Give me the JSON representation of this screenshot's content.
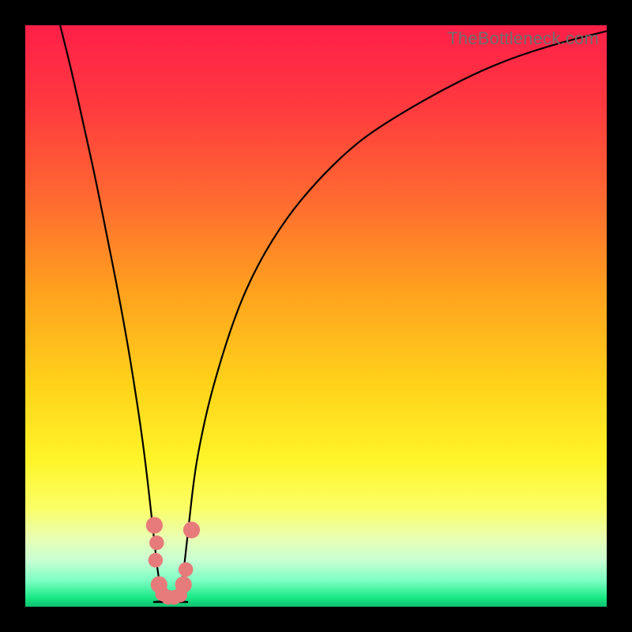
{
  "watermark": "TheBottleneck.com",
  "colors": {
    "frame": "#000000",
    "curve": "#000000",
    "dots": "#e77b7b",
    "gradient_stops": [
      {
        "pos": 0.0,
        "color": "#ff1f48"
      },
      {
        "pos": 0.14,
        "color": "#ff3a3f"
      },
      {
        "pos": 0.3,
        "color": "#ff6a30"
      },
      {
        "pos": 0.46,
        "color": "#ffa21e"
      },
      {
        "pos": 0.62,
        "color": "#ffd31a"
      },
      {
        "pos": 0.75,
        "color": "#fff52a"
      },
      {
        "pos": 0.83,
        "color": "#fbff66"
      },
      {
        "pos": 0.88,
        "color": "#eaffb0"
      },
      {
        "pos": 0.92,
        "color": "#c8ffd4"
      },
      {
        "pos": 0.955,
        "color": "#7dffc3"
      },
      {
        "pos": 0.985,
        "color": "#17e884"
      },
      {
        "pos": 1.0,
        "color": "#0fc06f"
      }
    ]
  },
  "chart_data": {
    "type": "line",
    "title": "",
    "xlabel": "",
    "ylabel": "",
    "xlim": [
      0,
      100
    ],
    "ylim": [
      0,
      100
    ],
    "notch_x": 25,
    "notch_half_width": 3,
    "series": [
      {
        "name": "bottleneck-curve",
        "x": [
          6,
          8,
          10,
          12,
          14,
          16,
          18,
          20,
          21,
          22,
          23,
          24,
          25,
          26,
          27,
          28,
          29,
          30,
          32,
          36,
          40,
          45,
          50,
          55,
          60,
          70,
          80,
          90,
          100
        ],
        "y": [
          100,
          92,
          83,
          74,
          64,
          54,
          43,
          30,
          22,
          13,
          4,
          1,
          0.5,
          1,
          4,
          13,
          22,
          28,
          37,
          50,
          59,
          67,
          73,
          78,
          82,
          88,
          93,
          96.5,
          99
        ]
      }
    ],
    "dots": [
      {
        "x": 22.2,
        "y": 14,
        "r": 1.6
      },
      {
        "x": 22.6,
        "y": 11,
        "r": 1.4
      },
      {
        "x": 22.4,
        "y": 8,
        "r": 1.4
      },
      {
        "x": 23.0,
        "y": 3.8,
        "r": 1.6
      },
      {
        "x": 23.6,
        "y": 2.2,
        "r": 1.4
      },
      {
        "x": 24.6,
        "y": 1.6,
        "r": 1.4
      },
      {
        "x": 25.6,
        "y": 1.6,
        "r": 1.4
      },
      {
        "x": 26.6,
        "y": 2.0,
        "r": 1.4
      },
      {
        "x": 27.2,
        "y": 3.8,
        "r": 1.6
      },
      {
        "x": 27.6,
        "y": 6.4,
        "r": 1.4
      },
      {
        "x": 28.6,
        "y": 13.2,
        "r": 1.6
      }
    ]
  }
}
